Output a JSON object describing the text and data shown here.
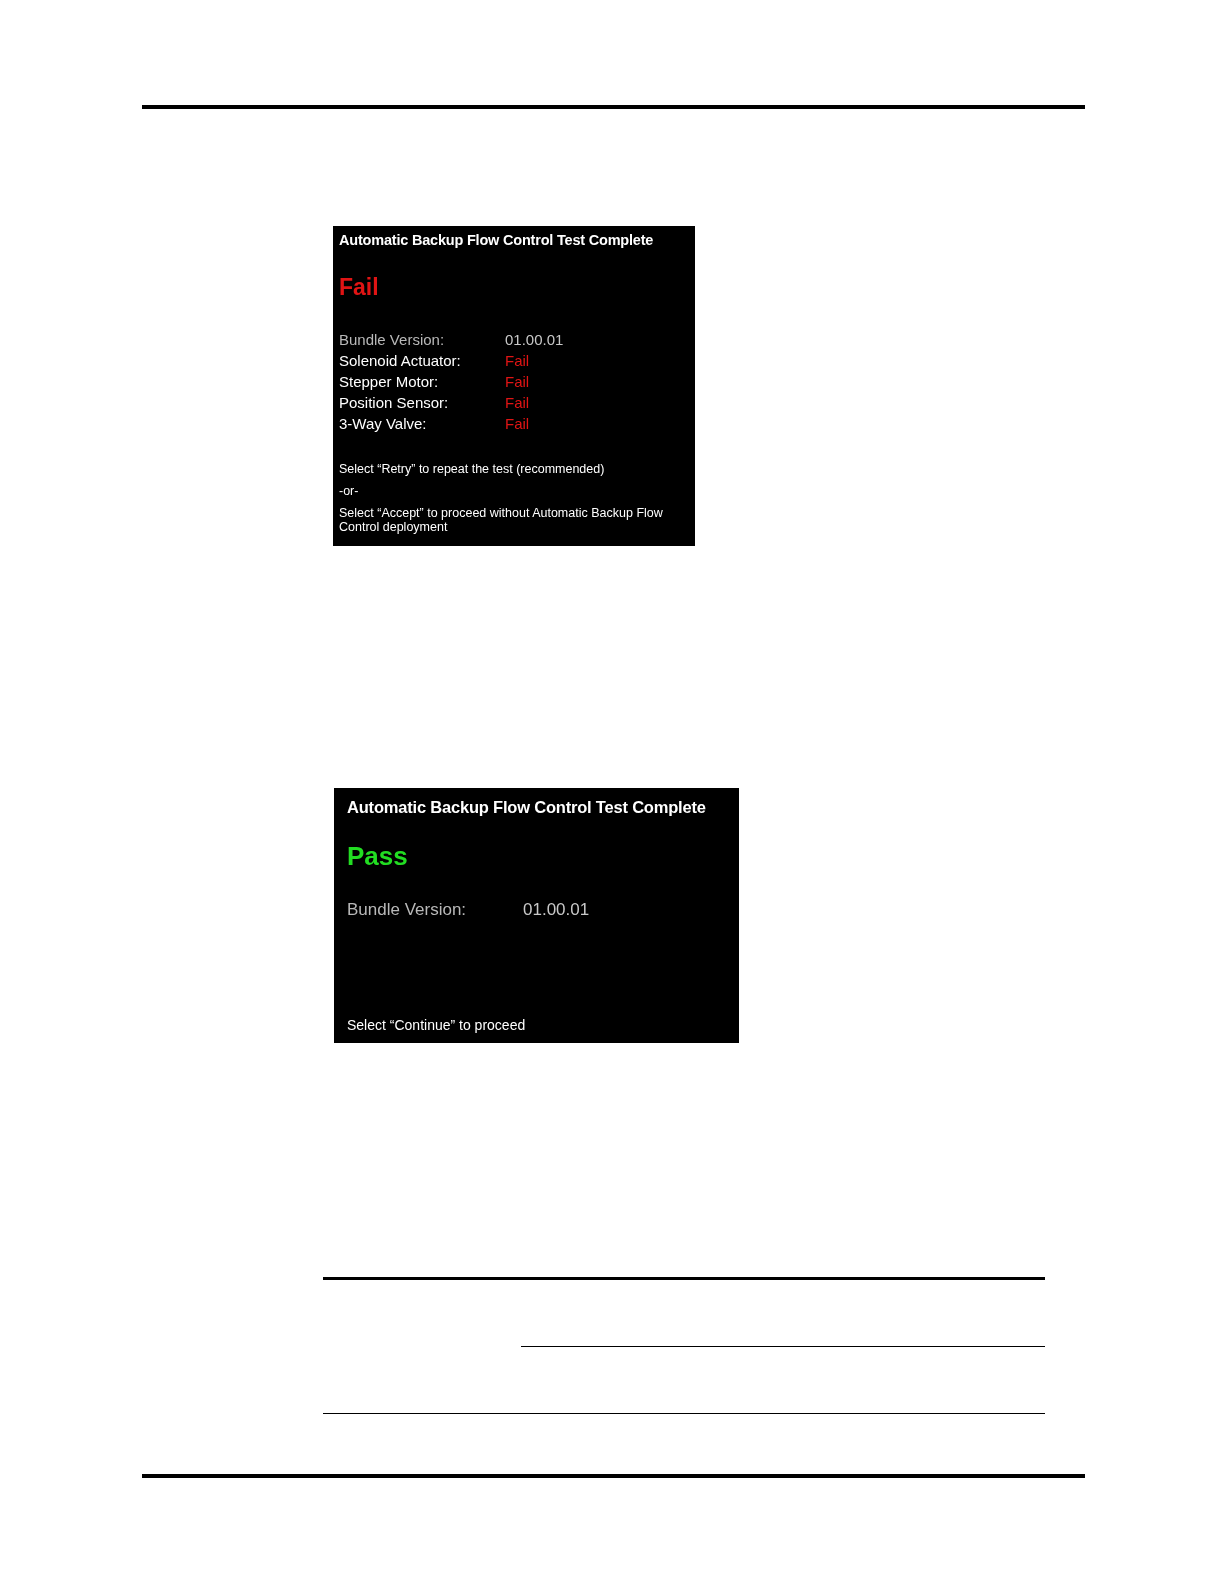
{
  "screens": [
    {
      "title": "Automatic Backup Flow Control Test Complete",
      "result": {
        "text": "Fail",
        "kind": "fail"
      },
      "rows": [
        {
          "label": "Bundle Version:",
          "value": "01.00.01",
          "kind": "info"
        },
        {
          "label": "Solenoid Actuator:",
          "value": "Fail",
          "kind": "fail"
        },
        {
          "label": "Stepper Motor:",
          "value": "Fail",
          "kind": "fail"
        },
        {
          "label": "Position Sensor:",
          "value": "Fail",
          "kind": "fail"
        },
        {
          "label": "3-Way Valve:",
          "value": "Fail",
          "kind": "fail"
        }
      ],
      "messages": [
        "Select “Retry” to repeat the test (recommended)",
        "-or-",
        "Select “Accept” to proceed without Automatic Backup Flow Control deployment"
      ]
    },
    {
      "title": "Automatic Backup Flow Control Test Complete",
      "result": {
        "text": "Pass",
        "kind": "pass"
      },
      "rows": [
        {
          "label": "Bundle Version:",
          "value": "01.00.01",
          "kind": "info"
        }
      ],
      "messages": [
        "Select “Continue” to proceed"
      ]
    }
  ]
}
